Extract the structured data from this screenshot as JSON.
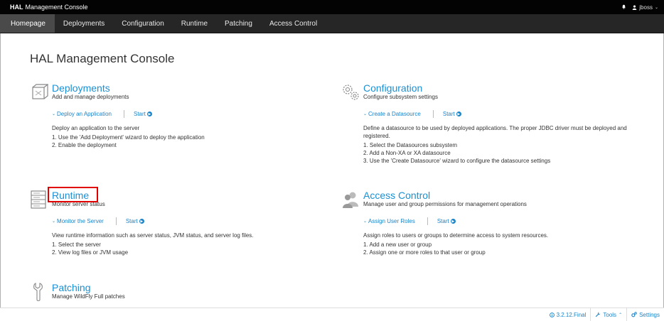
{
  "topbar": {
    "brand_bold": "HAL",
    "brand_rest": "Management Console",
    "user": "jboss"
  },
  "nav": {
    "items": [
      "Homepage",
      "Deployments",
      "Configuration",
      "Runtime",
      "Patching",
      "Access Control"
    ],
    "active": "Homepage"
  },
  "main": {
    "title": "HAL Management Console",
    "deployments": {
      "title": "Deployments",
      "subtitle": "Add and manage deployments",
      "action": "Deploy an Application",
      "start": "Start",
      "desc": "Deploy an application to the server",
      "steps": [
        "1.  Use the 'Add Deployment' wizard to deploy the application",
        "2.  Enable the deployment"
      ]
    },
    "configuration": {
      "title": "Configuration",
      "subtitle": "Configure subsystem settings",
      "action": "Create a Datasource",
      "start": "Start",
      "desc": "Define a datasource to be used by deployed applications. The proper JDBC driver must be deployed and registered.",
      "steps": [
        "1.  Select the Datasources subsystem",
        "2.  Add a Non-XA or XA datasource",
        "3.  Use the 'Create Datasource' wizard to configure the datasource settings"
      ]
    },
    "runtime": {
      "title": "Runtime",
      "subtitle": "Monitor server status",
      "action": "Monitor the Server",
      "start": "Start",
      "desc": "View runtime information such as server status, JVM status, and server log files.",
      "steps": [
        "1.  Select the server",
        "2.  View log files or JVM usage"
      ]
    },
    "access": {
      "title": "Access Control",
      "subtitle": "Manage user and group permissions for management operations",
      "action": "Assign User Roles",
      "start": "Start",
      "desc": "Assign roles to users or groups to determine access to system resources.",
      "steps": [
        "1.  Add a new user or group",
        "2.  Assign one or more roles to that user or group"
      ]
    },
    "patching": {
      "title": "Patching",
      "subtitle": "Manage WildFly Full patches"
    }
  },
  "footer": {
    "version": "3.2.12.Final",
    "tools": "Tools",
    "settings": "Settings"
  },
  "colors": {
    "accent": "#1a90d4",
    "highlight": "#e00000",
    "topbar": "#030303",
    "nav": "#262626"
  },
  "icons": [
    "bell-icon",
    "user-icon",
    "deployments-icon",
    "configuration-icon",
    "runtime-icon",
    "access-control-icon",
    "patching-icon",
    "chevron-down-icon",
    "arrow-circle-right-icon",
    "info-icon",
    "wrench-icon",
    "gears-icon"
  ]
}
